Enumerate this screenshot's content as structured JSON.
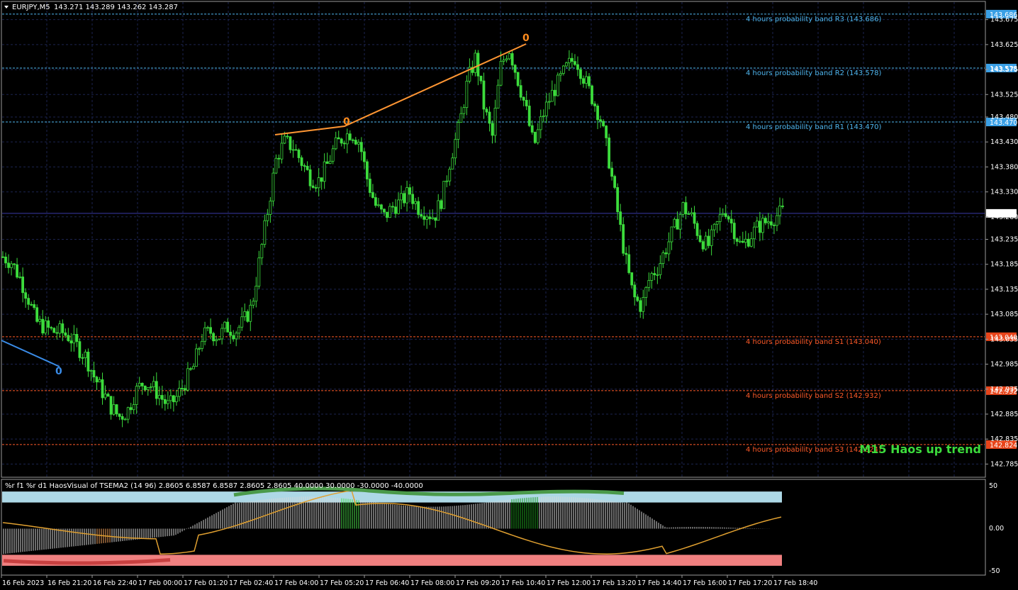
{
  "header": {
    "symbol_label": "EURJPY,M5",
    "ohlc": "143.271 143.289 143.262 143.287"
  },
  "indicator": {
    "label": "%r f1 %r d1 HaosVisual of TSEMA2 (14 96) 2.8605 6.8587 6.8587 2.8605 2.8605 40.0000 30.0000 -30.0000 -40.0000",
    "scale": [
      "50",
      "0.00",
      "-50"
    ]
  },
  "trend_label": "M15 Haos up trend",
  "colors": {
    "background": "#000000",
    "grid": "#1c2450",
    "candle": "#3cdc3c",
    "resistance": "#4fb7f0",
    "support": "#ff5a28",
    "trendline": "#ff9633",
    "current_price_bg": "#ffffff"
  },
  "bands": [
    {
      "name": "R3",
      "label": "4 hours probability band R3 (143.686)",
      "price": 143.686,
      "tag": "143.686",
      "kind": "resistance"
    },
    {
      "name": "R2",
      "label": "4 hours probability band R2 (143.578)",
      "price": 143.578,
      "tag": "143.578",
      "kind": "resistance"
    },
    {
      "name": "R1",
      "label": "4 hours probability band R1 (143.470)",
      "price": 143.47,
      "tag": "143.470",
      "kind": "resistance"
    },
    {
      "name": "S1",
      "label": "4 hours probability band S1 (143.040)",
      "price": 143.04,
      "tag": "143.040",
      "kind": "support"
    },
    {
      "name": "S2",
      "label": "4 hours probability band S2 (142.932)",
      "price": 142.932,
      "tag": "142.932",
      "kind": "support"
    },
    {
      "name": "S3",
      "label": "4 hours probability band S3 (142.824)",
      "price": 142.824,
      "tag": "142.824",
      "kind": "support"
    }
  ],
  "current_price": {
    "value": 143.287,
    "tag": "143.287"
  },
  "price_ticks": [
    "143.675",
    "143.625",
    "143.575",
    "143.525",
    "143.480",
    "143.430",
    "143.380",
    "143.330",
    "143.280",
    "143.235",
    "143.185",
    "143.135",
    "143.085",
    "143.035",
    "142.985",
    "142.935",
    "142.885",
    "142.835",
    "142.785"
  ],
  "time_ticks": [
    "16 Feb 2023",
    "16 Feb 21:20",
    "16 Feb 22:40",
    "17 Feb 00:00",
    "17 Feb 01:20",
    "17 Feb 02:40",
    "17 Feb 04:00",
    "17 Feb 05:20",
    "17 Feb 06:40",
    "17 Feb 08:00",
    "17 Feb 09:20",
    "17 Feb 10:40",
    "17 Feb 12:00",
    "17 Feb 13:20",
    "17 Feb 14:40",
    "17 Feb 16:00",
    "17 Feb 17:20",
    "17 Feb 18:40"
  ],
  "chart_data": {
    "type": "candlestick",
    "symbol": "EURJPY",
    "timeframe": "M5",
    "ylim": [
      142.76,
      143.71
    ],
    "close_path": [
      143.2,
      143.19,
      143.16,
      143.12,
      143.07,
      143.06,
      143.05,
      143.05,
      143.04,
      143.02,
      143.0,
      142.96,
      142.93,
      142.9,
      142.88,
      142.89,
      142.93,
      142.95,
      142.94,
      142.92,
      142.9,
      142.92,
      142.95,
      142.98,
      143.04,
      143.05,
      143.04,
      143.06,
      143.05,
      143.07,
      143.1,
      143.2,
      143.3,
      143.4,
      143.43,
      143.42,
      143.39,
      143.36,
      143.35,
      143.38,
      143.42,
      143.44,
      143.45,
      143.43,
      143.35,
      143.3,
      143.28,
      143.3,
      143.31,
      143.33,
      143.3,
      143.29,
      143.28,
      143.32,
      143.4,
      143.46,
      143.55,
      143.6,
      143.5,
      143.44,
      143.58,
      143.62,
      143.56,
      143.5,
      143.42,
      143.48,
      143.52,
      143.55,
      143.58,
      143.6,
      143.56,
      143.52,
      143.48,
      143.4,
      143.3,
      143.2,
      143.12,
      143.1,
      143.16,
      143.18,
      143.22,
      143.26,
      143.3,
      143.28,
      143.24,
      143.22,
      143.26,
      143.3,
      143.26,
      143.22,
      143.24,
      143.26,
      143.27,
      143.28,
      143.29
    ],
    "annotations": [
      "up fractal near 142.99",
      "down fractal near 143.47",
      "down fractal near 143.66"
    ]
  }
}
